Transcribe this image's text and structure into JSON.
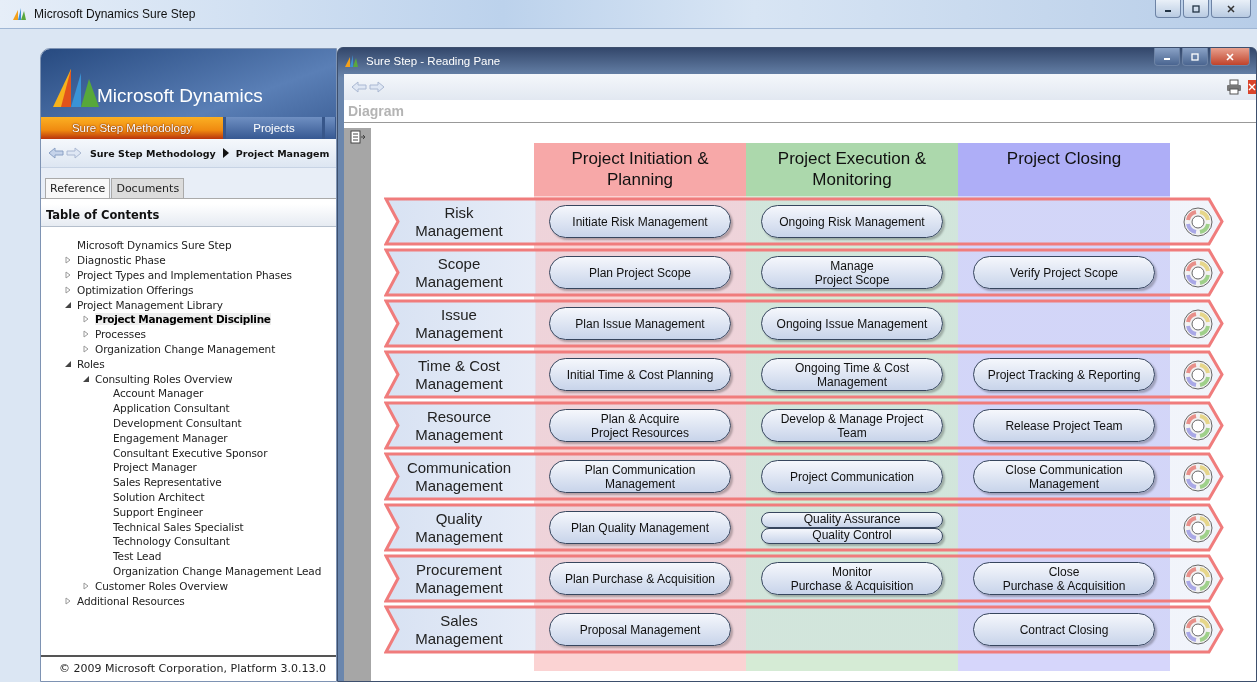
{
  "window": {
    "title": "Microsoft Dynamics Sure Step"
  },
  "app": {
    "logo": "Microsoft Dynamics",
    "tabs": [
      {
        "label": "Sure Step Methodology",
        "selected": true
      },
      {
        "label": "Projects",
        "selected": false
      }
    ],
    "breadcrumb": [
      "Sure Step Methodology",
      "Project Managem"
    ],
    "view_tabs": [
      {
        "label": "Reference",
        "selected": true
      },
      {
        "label": "Documents",
        "selected": false
      }
    ],
    "toc_title": "Table of Contents",
    "toc": [
      {
        "label": "Microsoft Dynamics Sure Step",
        "selected": false
      },
      {
        "label": "Diagnostic Phase",
        "expanded": false,
        "selected": false
      },
      {
        "label": "Project Types and Implementation Phases",
        "expanded": false,
        "selected": false
      },
      {
        "label": "Optimization Offerings",
        "expanded": false,
        "selected": false
      },
      {
        "label": "Project Management Library",
        "expanded": true,
        "selected": false,
        "children": [
          {
            "label": "Project Management Discipline",
            "expanded": false,
            "selected": true
          },
          {
            "label": "Processes",
            "expanded": false,
            "selected": false
          },
          {
            "label": "Organization Change Management",
            "expanded": false,
            "selected": false
          }
        ]
      },
      {
        "label": "Roles",
        "expanded": true,
        "selected": false,
        "children": [
          {
            "label": "Consulting Roles Overview",
            "expanded": true,
            "selected": false,
            "children": [
              {
                "label": "Account Manager",
                "selected": false
              },
              {
                "label": "Application Consultant",
                "selected": false
              },
              {
                "label": "Development Consultant",
                "selected": false
              },
              {
                "label": "Engagement Manager",
                "selected": false
              },
              {
                "label": "Consultant Executive Sponsor",
                "selected": false
              },
              {
                "label": "Project Manager",
                "selected": false
              },
              {
                "label": "Sales Representative",
                "selected": false
              },
              {
                "label": "Solution Architect",
                "selected": false
              },
              {
                "label": "Support Engineer",
                "selected": false
              },
              {
                "label": "Technical Sales Specialist",
                "selected": false
              },
              {
                "label": "Technology Consultant",
                "selected": false
              },
              {
                "label": "Test Lead",
                "selected": false
              },
              {
                "label": "Organization Change Management Lead",
                "selected": false
              }
            ]
          },
          {
            "label": "Customer Roles Overview",
            "expanded": false,
            "selected": false
          }
        ]
      },
      {
        "label": "Additional Resources",
        "expanded": false,
        "selected": false
      }
    ],
    "footer": "© 2009 Microsoft Corporation, Platform 3.0.13.0"
  },
  "reading_pane": {
    "title": "Sure Step - Reading Pane",
    "section": "Diagram",
    "phases": [
      {
        "label": "Project Initiation &\nPlanning",
        "color": "#f7a8a8"
      },
      {
        "label": "Project Execution &\nMonitoring",
        "color": "#acd8ac"
      },
      {
        "label": "Project Closing",
        "color": "#aeaef7"
      }
    ],
    "rows": [
      {
        "label": "Risk\nManagement",
        "cells": [
          [
            "Initiate Risk Management"
          ],
          [
            "Ongoing Risk Management"
          ],
          null
        ]
      },
      {
        "label": "Scope\nManagement",
        "cells": [
          [
            "Plan Project Scope"
          ],
          [
            "Manage\nProject Scope"
          ],
          [
            "Verify Project Scope"
          ]
        ]
      },
      {
        "label": "Issue\nManagement",
        "cells": [
          [
            "Plan Issue Management"
          ],
          [
            "Ongoing Issue Management"
          ],
          null
        ]
      },
      {
        "label": "Time & Cost\nManagement",
        "cells": [
          [
            "Initial Time & Cost Planning"
          ],
          [
            "Ongoing Time & Cost\nManagement"
          ],
          [
            "Project Tracking & Reporting"
          ]
        ]
      },
      {
        "label": "Resource\nManagement",
        "cells": [
          [
            "Plan & Acquire\nProject Resources"
          ],
          [
            "Develop & Manage Project\nTeam"
          ],
          [
            "Release Project Team"
          ]
        ]
      },
      {
        "label": "Communication\nManagement",
        "cells": [
          [
            "Plan Communication\nManagement"
          ],
          [
            "Project Communication"
          ],
          [
            "Close Communication\nManagement"
          ]
        ]
      },
      {
        "label": "Quality\nManagement",
        "cells": [
          [
            "Plan Quality Management"
          ],
          [
            "Quality Assurance",
            "Quality Control"
          ],
          null
        ]
      },
      {
        "label": "Procurement\nManagement",
        "cells": [
          [
            "Plan Purchase & Acquisition"
          ],
          [
            "Monitor\nPurchase & Acquisition"
          ],
          [
            "Close\nPurchase & Acquisition"
          ]
        ]
      },
      {
        "label": "Sales\nManagement",
        "cells": [
          [
            "Proposal Management"
          ],
          null,
          [
            "Contract Closing"
          ]
        ]
      }
    ]
  }
}
